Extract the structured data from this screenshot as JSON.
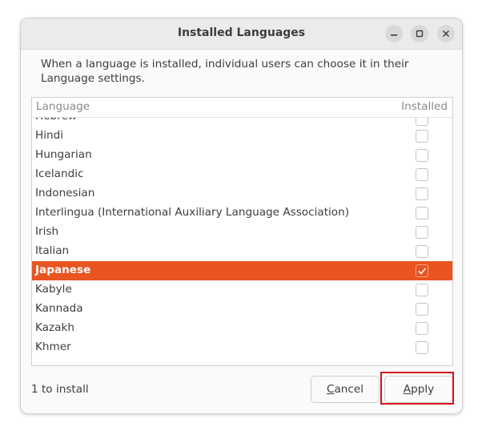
{
  "window": {
    "title": "Installed Languages"
  },
  "description": "When a language is installed, individual users can choose it in their Language settings.",
  "list": {
    "columns": {
      "language": "Language",
      "installed": "Installed"
    },
    "rows": [
      {
        "name": "Hebrew",
        "installed": false
      },
      {
        "name": "Hindi",
        "installed": false
      },
      {
        "name": "Hungarian",
        "installed": false
      },
      {
        "name": "Icelandic",
        "installed": false
      },
      {
        "name": "Indonesian",
        "installed": false
      },
      {
        "name": "Interlingua (International Auxiliary Language Association)",
        "installed": false
      },
      {
        "name": "Irish",
        "installed": false
      },
      {
        "name": "Italian",
        "installed": false
      },
      {
        "name": "Japanese",
        "installed": true,
        "selected": true
      },
      {
        "name": "Kabyle",
        "installed": false
      },
      {
        "name": "Kannada",
        "installed": false
      },
      {
        "name": "Kazakh",
        "installed": false
      },
      {
        "name": "Khmer",
        "installed": false
      }
    ]
  },
  "footer": {
    "status": "1 to install",
    "cancel_label_mnemonic": "C",
    "cancel_label_rest": "ancel",
    "apply_label_mnemonic": "A",
    "apply_label_rest": "pply"
  },
  "colors": {
    "accent": "#e95420",
    "highlight_outline": "#d4101b"
  }
}
